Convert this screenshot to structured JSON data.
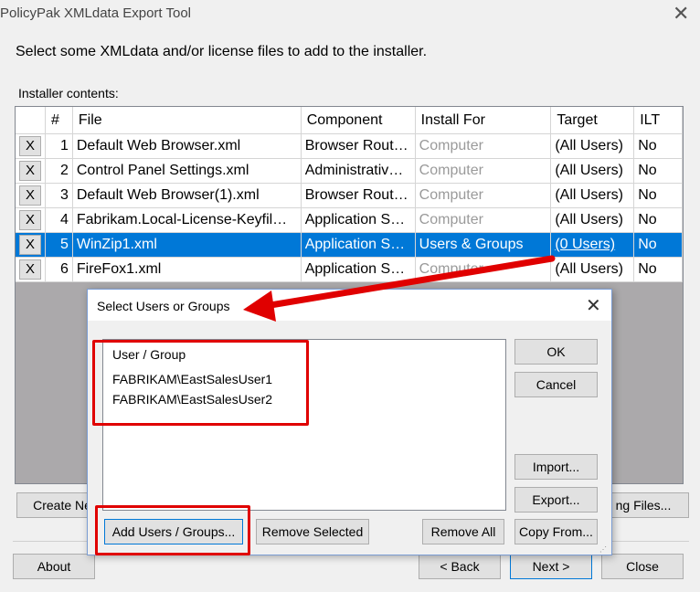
{
  "window": {
    "title": "PolicyPak XMLdata Export Tool",
    "close_glyph": "✕"
  },
  "prompt": "Select some XMLdata and/or license files to add to the installer.",
  "contents_label": "Installer contents:",
  "table": {
    "headers": [
      "",
      "#",
      "File",
      "Component",
      "Install For",
      "Target",
      "ILT"
    ],
    "rows": [
      {
        "x": "X",
        "num": "1",
        "file": "Default Web Browser.xml",
        "component": "Browser Rout…",
        "install_for": "Computer",
        "target": "(All Users)",
        "ilt": "No"
      },
      {
        "x": "X",
        "num": "2",
        "file": "Control Panel Settings.xml",
        "component": "Administrativ…",
        "install_for": "Computer",
        "target": "(All Users)",
        "ilt": "No"
      },
      {
        "x": "X",
        "num": "3",
        "file": "Default Web Browser(1).xml",
        "component": "Browser Rout…",
        "install_for": "Computer",
        "target": "(All Users)",
        "ilt": "No"
      },
      {
        "x": "X",
        "num": "4",
        "file": "Fabrikam.Local-License-Keyfil…",
        "component": "Application S…",
        "install_for": "Computer",
        "target": "(All Users)",
        "ilt": "No"
      },
      {
        "x": "X",
        "num": "5",
        "file": "WinZip1.xml",
        "component": "Application S…",
        "install_for": "Users & Groups",
        "target": "(0 Users)",
        "ilt": "No"
      },
      {
        "x": "X",
        "num": "6",
        "file": "FireFox1.xml",
        "component": "Application S…",
        "install_for": "Computer",
        "target": "(All Users)",
        "ilt": "No"
      }
    ]
  },
  "buttons": {
    "create_new": "Create Ne",
    "existing_files": "ng Files...",
    "about": "About",
    "back": "< Back",
    "next": "Next >",
    "close": "Close"
  },
  "dialog": {
    "title": "Select Users or Groups",
    "close_glyph": "✕",
    "list_header": "User / Group",
    "users": [
      "FABRIKAM\\EastSalesUser1",
      "FABRIKAM\\EastSalesUser2"
    ],
    "ok": "OK",
    "cancel": "Cancel",
    "import": "Import...",
    "export": "Export...",
    "add_users": "Add Users / Groups...",
    "remove_selected": "Remove Selected",
    "remove_all": "Remove All",
    "copy_from": "Copy From..."
  },
  "colors": {
    "selection": "#0078d7",
    "annotation_red": "#e00000"
  }
}
